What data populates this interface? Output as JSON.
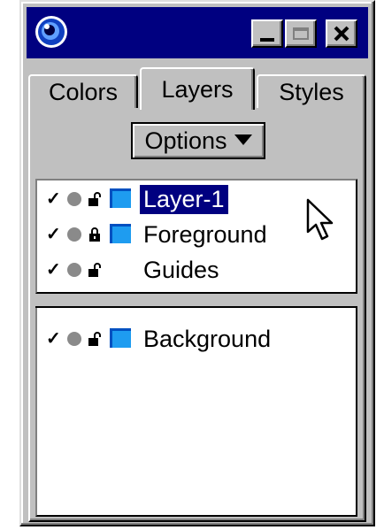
{
  "window": {
    "title_icon": "app-swirl-icon",
    "buttons": [
      "minimize-icon",
      "maximize-icon",
      "close-icon"
    ]
  },
  "tabs": [
    {
      "label": "Colors",
      "active": false
    },
    {
      "label": "Layers",
      "active": true
    },
    {
      "label": "Styles",
      "active": false
    }
  ],
  "options_button": {
    "label": "Options"
  },
  "layers_top": [
    {
      "name": "Layer-1",
      "visible": true,
      "locked": false,
      "has_swatch": true,
      "selected": true
    },
    {
      "name": "Foreground",
      "visible": true,
      "locked": true,
      "has_swatch": true,
      "selected": false
    },
    {
      "name": "Guides",
      "visible": true,
      "locked": false,
      "has_swatch": false,
      "selected": false
    }
  ],
  "layers_bottom": [
    {
      "name": "Background",
      "visible": true,
      "locked": false,
      "has_swatch": true,
      "selected": false
    }
  ],
  "colors": {
    "titlebar": "#000080",
    "face": "#c0c0c0",
    "layer_swatch": "#1e9cf0",
    "selection": "#000080"
  },
  "check_glyph": "✓"
}
